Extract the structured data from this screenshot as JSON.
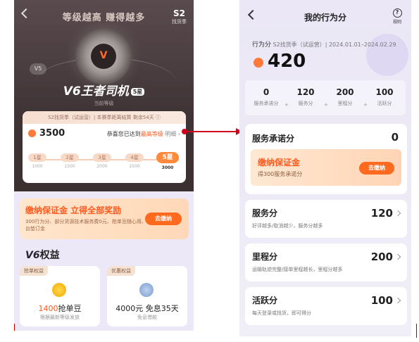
{
  "left": {
    "header": {
      "title": "等级越高 赚得越多",
      "season_code": "S2",
      "season_label": "找货季"
    },
    "hero": {
      "prev_level": "V5",
      "level_name": "V6王者司机",
      "level_star": "5星",
      "level_sub": "当前等级",
      "wheel_logo": "V"
    },
    "score_card": {
      "head_text": "S2找货季（试运营）| 本赛季距离结算 剩余54天 ⓘ",
      "score": "3500",
      "msg_prefix": "恭喜您已达到",
      "msg_highlight": "最高等级",
      "msg_more": "明细 ›",
      "steps": [
        {
          "label": "1星",
          "value": "1000"
        },
        {
          "label": "2星",
          "value": "1500"
        },
        {
          "label": "3星",
          "value": "2000"
        },
        {
          "label": "4星",
          "value": "2500"
        },
        {
          "label": "5星",
          "value": "3000"
        }
      ]
    },
    "deposit": {
      "title": "缴纳保证金 立得全部奖励",
      "desc": "300行为分、部分货源技术服务费0元、抢单豆随心用、平台垫订金",
      "button": "去缴纳"
    },
    "benefits": {
      "heading_v": "V6",
      "heading_text": "权益",
      "items": [
        {
          "tag": "抢单权益",
          "main_accent": "1400",
          "main_text": "抢单豆",
          "sub": "根据最新等级发放"
        },
        {
          "tag": "优惠权益",
          "main_accent": "",
          "main_text": "4000元 免息35天",
          "sub": "免息借款"
        }
      ]
    }
  },
  "right": {
    "header": {
      "title": "我的行为分",
      "rule_label": "规则",
      "rule_icon": "?"
    },
    "meta": {
      "label": "行为分",
      "season": "S2找货季（试运营）| 2024.01.01–2024.02.29"
    },
    "total": "420",
    "breakdown": [
      {
        "value": "0",
        "label": "服务承诺分"
      },
      {
        "value": "120",
        "label": "服务分"
      },
      {
        "value": "200",
        "label": "里程分"
      },
      {
        "value": "100",
        "label": "活跃分"
      }
    ],
    "plus_sign": "+",
    "service_promise": {
      "title": "服务承诺分",
      "value": "0",
      "deposit_title": "缴纳保证金",
      "deposit_desc": "得300服务承诺分",
      "deposit_button": "去缴纳"
    },
    "rows": [
      {
        "title": "服务分",
        "value": "120",
        "desc": "好评越多/取消越少，服务分越多"
      },
      {
        "title": "里程分",
        "value": "200",
        "desc": "运输轨迹完整/接单里程越长，里程分越多"
      },
      {
        "title": "活跃分",
        "value": "100",
        "desc": "每天登录或找货，即可得分"
      }
    ]
  }
}
